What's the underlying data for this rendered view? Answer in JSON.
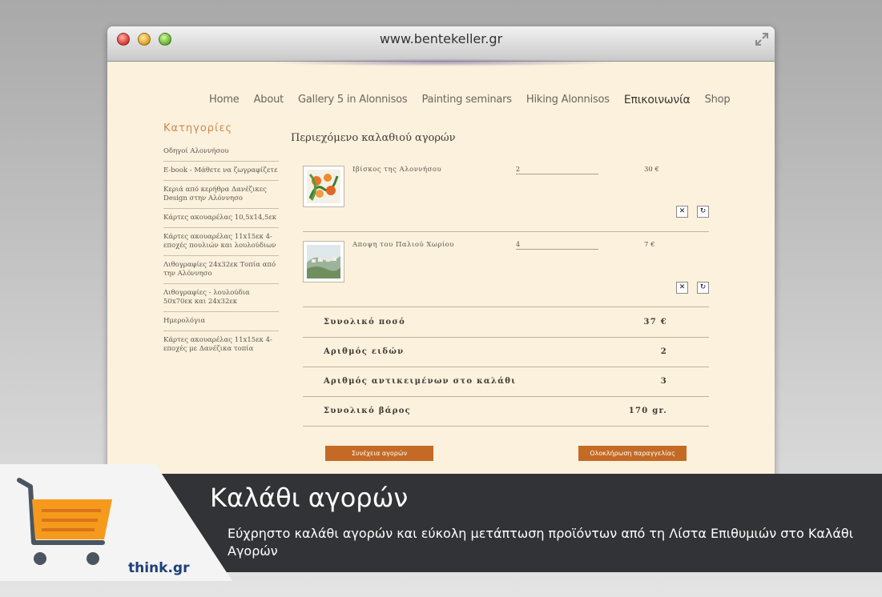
{
  "window": {
    "url": "www.bentekeller.gr"
  },
  "nav": {
    "items": [
      {
        "label": "Home"
      },
      {
        "label": "About"
      },
      {
        "label": "Gallery 5 in Alonnisos"
      },
      {
        "label": "Painting seminars"
      },
      {
        "label": "Hiking Alonnisos"
      },
      {
        "label": "Επικοινωνία"
      },
      {
        "label": "Shop"
      }
    ]
  },
  "sidebar": {
    "title": "Κατηγορίες",
    "items": [
      {
        "label": "Οδηγοί Αλοννήσου"
      },
      {
        "label": "E-book - Μάθετε να ζωγραφίζετε"
      },
      {
        "label": "Κεριά από κερήθρα Δανέζικες Design στην Αλόννησο"
      },
      {
        "label": "Κάρτες ακουαρέλας 10,5x14,5εκ"
      },
      {
        "label": "Κάρτες ακουαρέλας 11x15εκ 4-εποχές πουλιών και λουλούδιων"
      },
      {
        "label": "Λιθογραφίες 24x32εκ Τοπία από την Αλόννησο"
      },
      {
        "label": "Λιθογραφίες - λουλούδια 50x70εκ και 24x32εκ"
      },
      {
        "label": "Ημερολόγια"
      },
      {
        "label": "Κάρτες ακουαρέλας 11x15εκ 4-εποχές με Δανέζικα τοπία"
      }
    ]
  },
  "cart": {
    "title": "Περιεχόμενο καλαθιού αγορών",
    "items": [
      {
        "name": "Ιβίσκος της Αλοννήσου",
        "qty": "2",
        "price": "30 €"
      },
      {
        "name": "Αποψη του Παλιού Χωρίου",
        "qty": "4",
        "price": "7 €"
      }
    ],
    "summary": [
      {
        "label": "Συνολικό ποσό",
        "value": "37 €"
      },
      {
        "label": "Αριθμός ειδών",
        "value": "2"
      },
      {
        "label": "Αριθμός αντικειμένων στο καλάθι",
        "value": "3"
      },
      {
        "label": "Συνολικό βάρος",
        "value": "170 gr."
      }
    ],
    "continue_label": "Συνέχεια αγορών",
    "checkout_label": "Ολοκλήρωση παραγγελίας",
    "remove_symbol": "✕",
    "refresh_symbol": "↻"
  },
  "banner": {
    "title": "Καλάθι αγορών",
    "subtitle": "Εύχρηστο καλάθι αγορών και εύκολη μετάπτωση προϊόντων από τη Λίστα Επιθυμιών στο Καλάθι Αγορών",
    "logo_text": "think.gr"
  },
  "colors": {
    "page_bg": "#fcf1dd",
    "accent_orange": "#c46a24",
    "banner_bg": "#313336",
    "cart_icon_orange": "#f59a1c",
    "cart_icon_frame": "#4a5560"
  }
}
